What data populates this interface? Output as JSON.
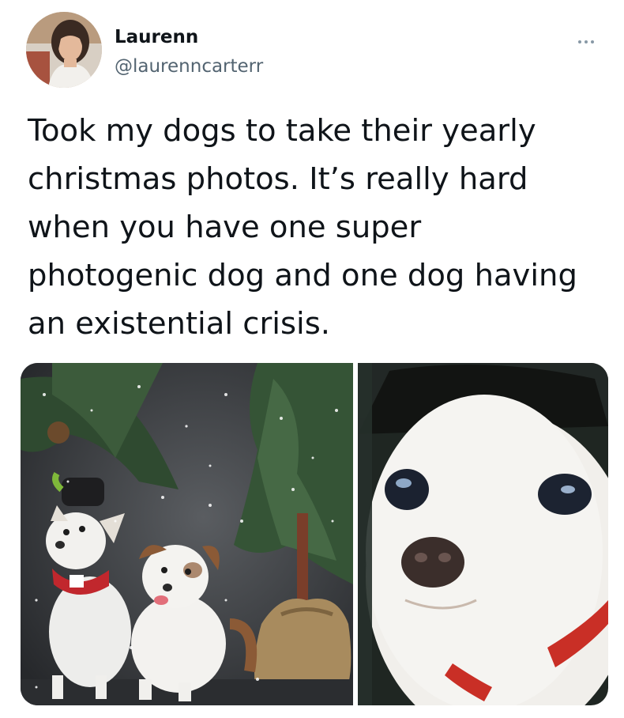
{
  "user": {
    "display_name": "Laurenn",
    "handle": "@laurenncarterr",
    "avatar_icon": "profile-photo"
  },
  "tweet": {
    "text": "Took my dogs to take their yearly\nchristmas photos. It’s really hard\nwhen you have one super\nphotogenic dog and one dog having\nan existential crisis."
  },
  "menu": {
    "icon": "more-horizontal-icon"
  },
  "media": {
    "count": 2,
    "photos": [
      {
        "subject": "two small white dogs in festive collars beside a snowy pine tree and burlap sack"
      },
      {
        "subject": "close-up of a white dog with a red collar"
      }
    ]
  },
  "colors": {
    "text": "#0f1419",
    "secondary_text": "#536471",
    "background": "#ffffff"
  }
}
